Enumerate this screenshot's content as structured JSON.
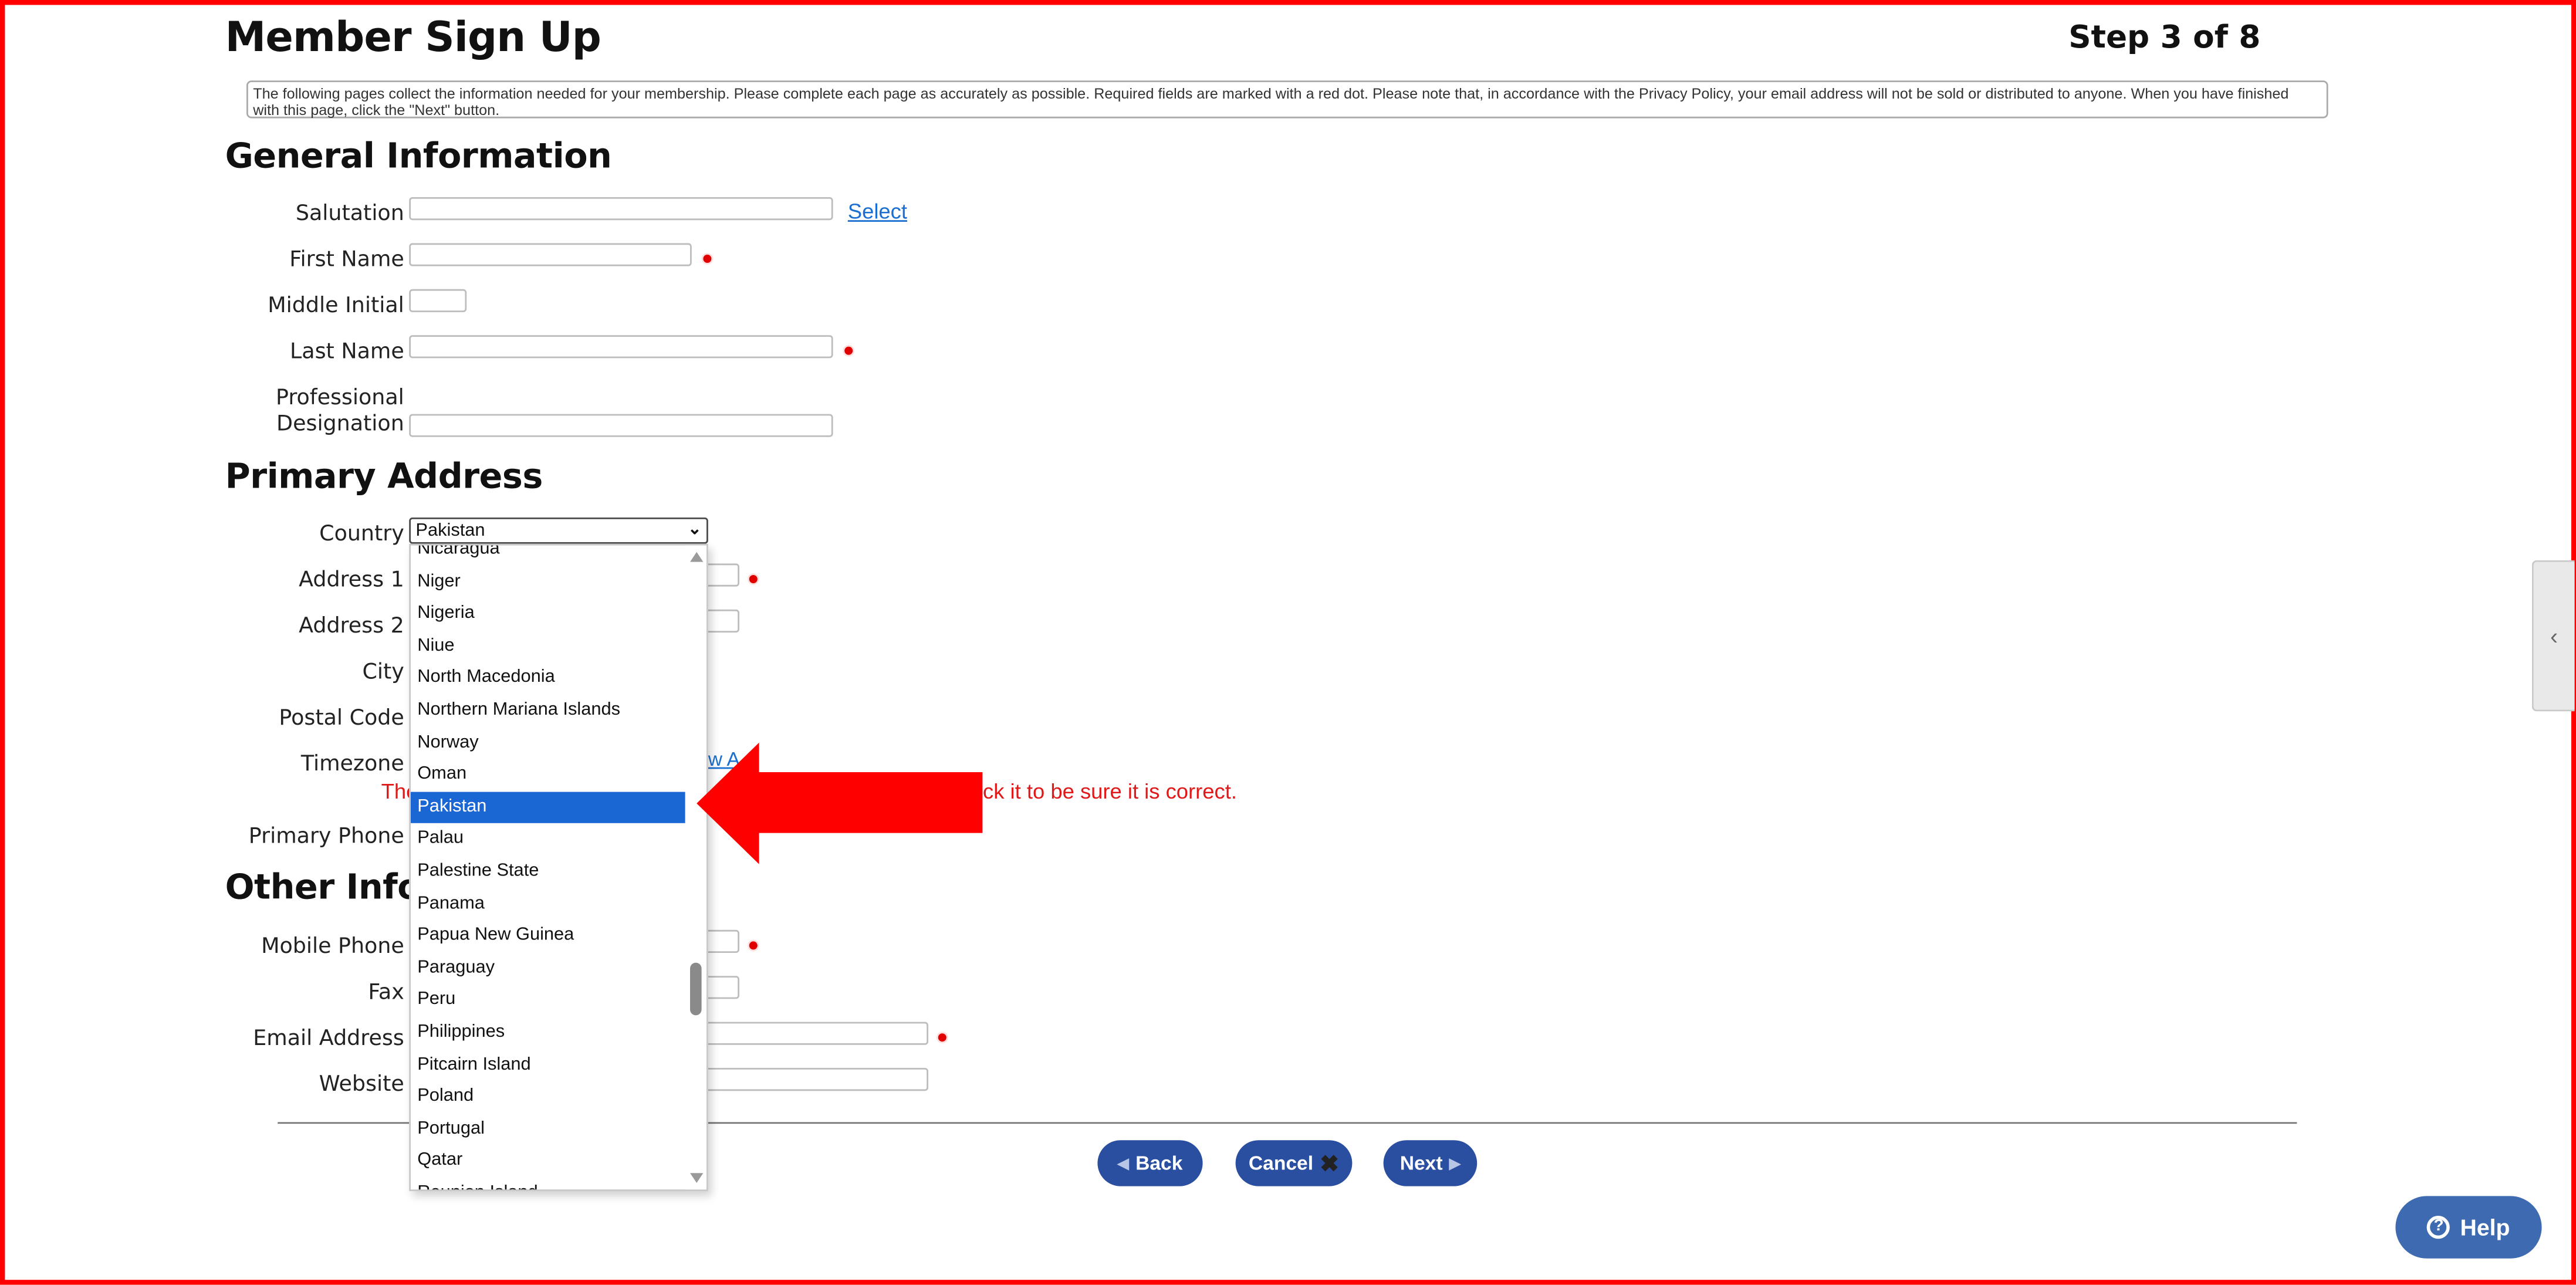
{
  "header": {
    "title": "Member Sign Up",
    "step": "Step 3 of 8",
    "intro": "The following pages collect the information needed for your membership. Please complete each page as accurately as possible. Required fields are marked with a red dot. Please note that, in accordance with the Privacy Policy, your email address will not be sold or distributed to anyone. When you have finished with this page, click the \"Next\" button."
  },
  "general": {
    "heading": "General Information",
    "salutation_label": "Salutation",
    "salutation_link": "Select",
    "first_name_label": "First Name",
    "middle_initial_label": "Middle Initial",
    "last_name_label": "Last Name",
    "prof_label_1": "Professional",
    "prof_label_2": "Designation"
  },
  "address": {
    "heading": "Primary Address",
    "country_label": "Country",
    "country_value": "Pakistan",
    "address1_label": "Address 1",
    "address2_label": "Address 2",
    "city_label": "City",
    "postal_label": "Postal Code",
    "timezone_label": "Timezone",
    "timezone_link_fragment": "w A",
    "warning_start": "The",
    "warning_end": "eck it to be sure it is correct.",
    "primary_phone_label": "Primary Phone"
  },
  "other": {
    "heading": "Other Info",
    "mobile_label": "Mobile Phone",
    "fax_label": "Fax",
    "email_label": "Email Address",
    "website_label": "Website"
  },
  "buttons": {
    "back": "Back",
    "cancel": "Cancel",
    "next": "Next",
    "help": "Help"
  },
  "dropdown": {
    "selected_index": 8,
    "items": [
      "Nicaragua",
      "Niger",
      "Nigeria",
      "Niue",
      "North Macedonia",
      "Northern Mariana Islands",
      "Norway",
      "Oman",
      "Pakistan",
      "Palau",
      "Palestine State",
      "Panama",
      "Papua New Guinea",
      "Paraguay",
      "Peru",
      "Philippines",
      "Pitcairn Island",
      "Poland",
      "Portugal",
      "Qatar",
      "Reunion Island"
    ]
  },
  "colors": {
    "frame": "#ff0000",
    "accent_button": "#2b4fa0",
    "selected_option": "#1a66d2",
    "required_dot": "#e00000",
    "arrow": "#ff0000"
  }
}
